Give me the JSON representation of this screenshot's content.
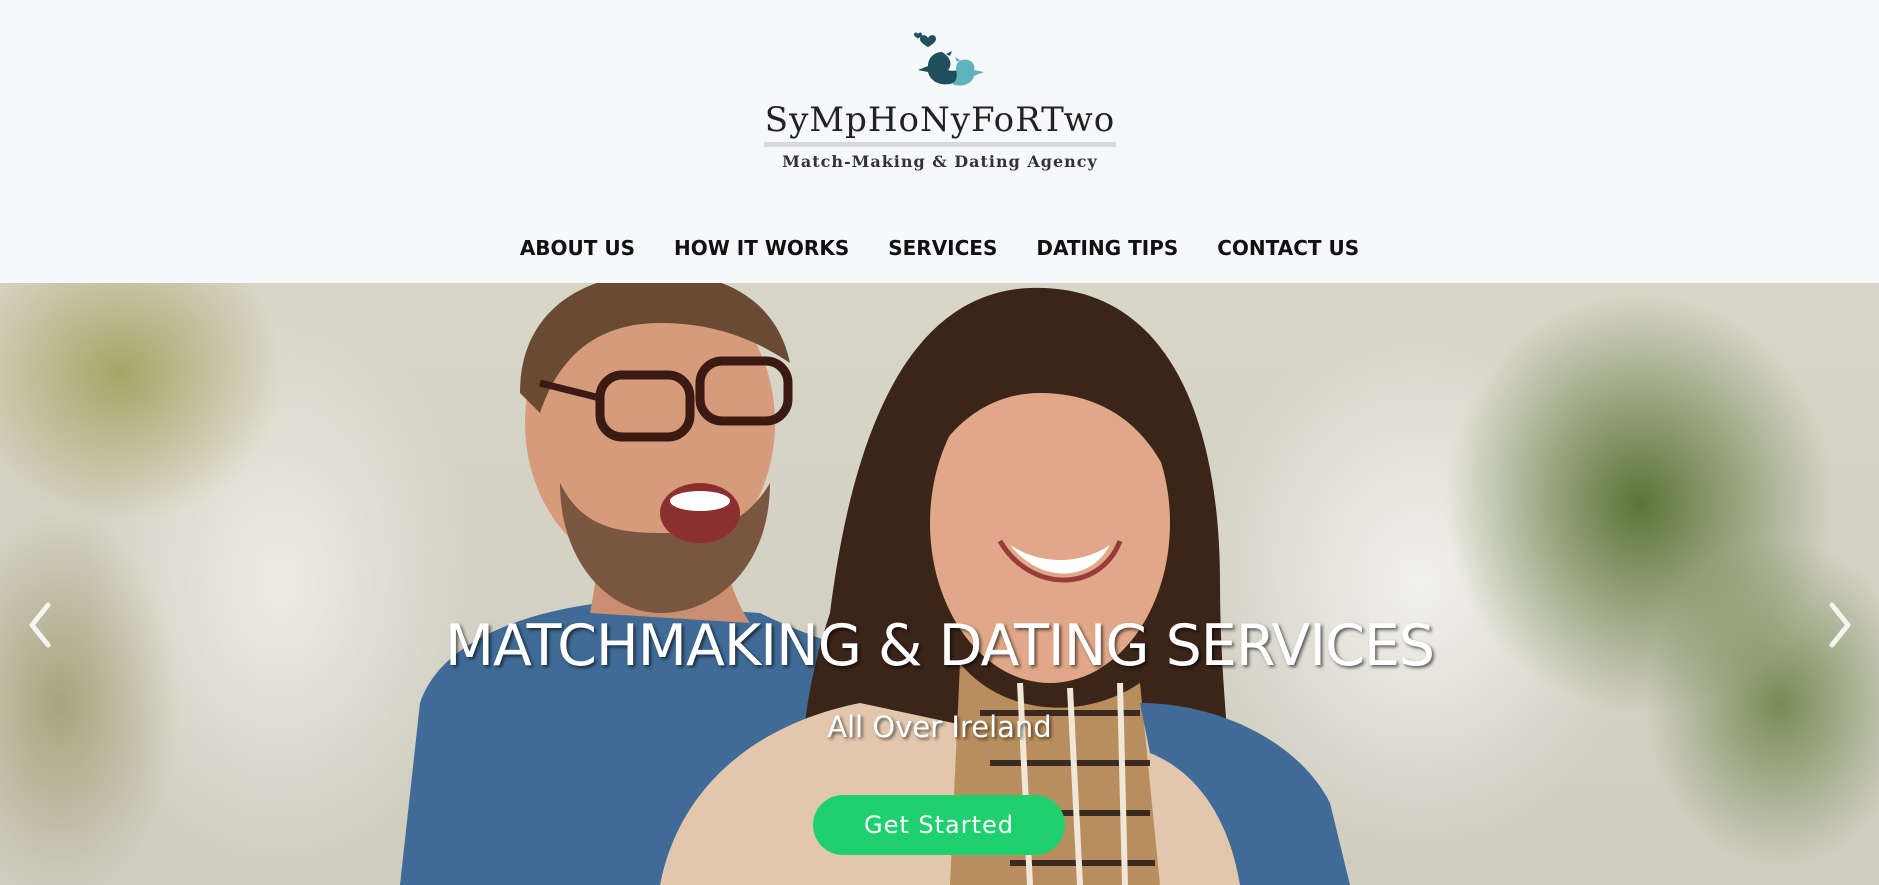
{
  "brand": {
    "name": "SyMpHoNyFoRTwo",
    "tagline": "Match-Making & Dating Agency",
    "logo_icon": "two-birds-hearts-icon",
    "colors": {
      "bird_dark": "#1f4f5a",
      "bird_light": "#5fb3bd",
      "heart": "#1f4f5a"
    }
  },
  "nav": {
    "items": [
      {
        "label": "ABOUT US"
      },
      {
        "label": "HOW IT WORKS"
      },
      {
        "label": "SERVICES"
      },
      {
        "label": "DATING TIPS"
      },
      {
        "label": "CONTACT US"
      }
    ]
  },
  "hero": {
    "headline": "MATCHMAKING & DATING SERVICES",
    "subheadline": "All Over Ireland",
    "cta_label": "Get Started",
    "cta_color": "#1ed16e",
    "prev_icon": "chevron-left-icon",
    "next_icon": "chevron-right-icon"
  }
}
